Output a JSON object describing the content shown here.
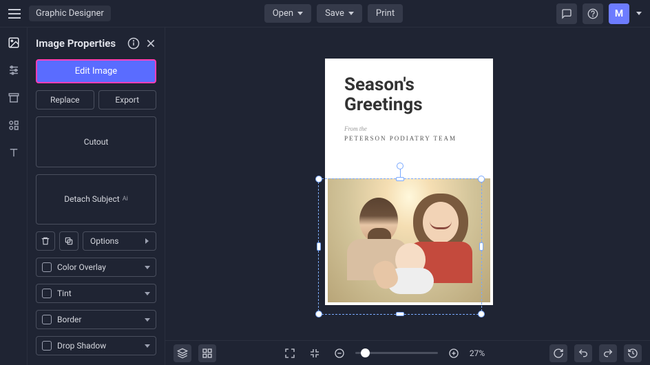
{
  "header": {
    "app_title": "Graphic Designer",
    "open": "Open",
    "save": "Save",
    "print": "Print",
    "user_initial": "M"
  },
  "panel": {
    "title": "Image Properties",
    "edit_image": "Edit Image",
    "replace": "Replace",
    "export": "Export",
    "cutout": "Cutout",
    "detach_subject": "Detach Subject",
    "ai_badge": "Ai",
    "options": "Options",
    "props": [
      {
        "label": "Color Overlay"
      },
      {
        "label": "Tint"
      },
      {
        "label": "Border"
      },
      {
        "label": "Drop Shadow"
      }
    ]
  },
  "card": {
    "title_line1": "Season's",
    "title_line2": "Greetings",
    "subtitle": "From the",
    "team": "PETERSON PODIATRY TEAM"
  },
  "bottom": {
    "zoom": "27%"
  }
}
